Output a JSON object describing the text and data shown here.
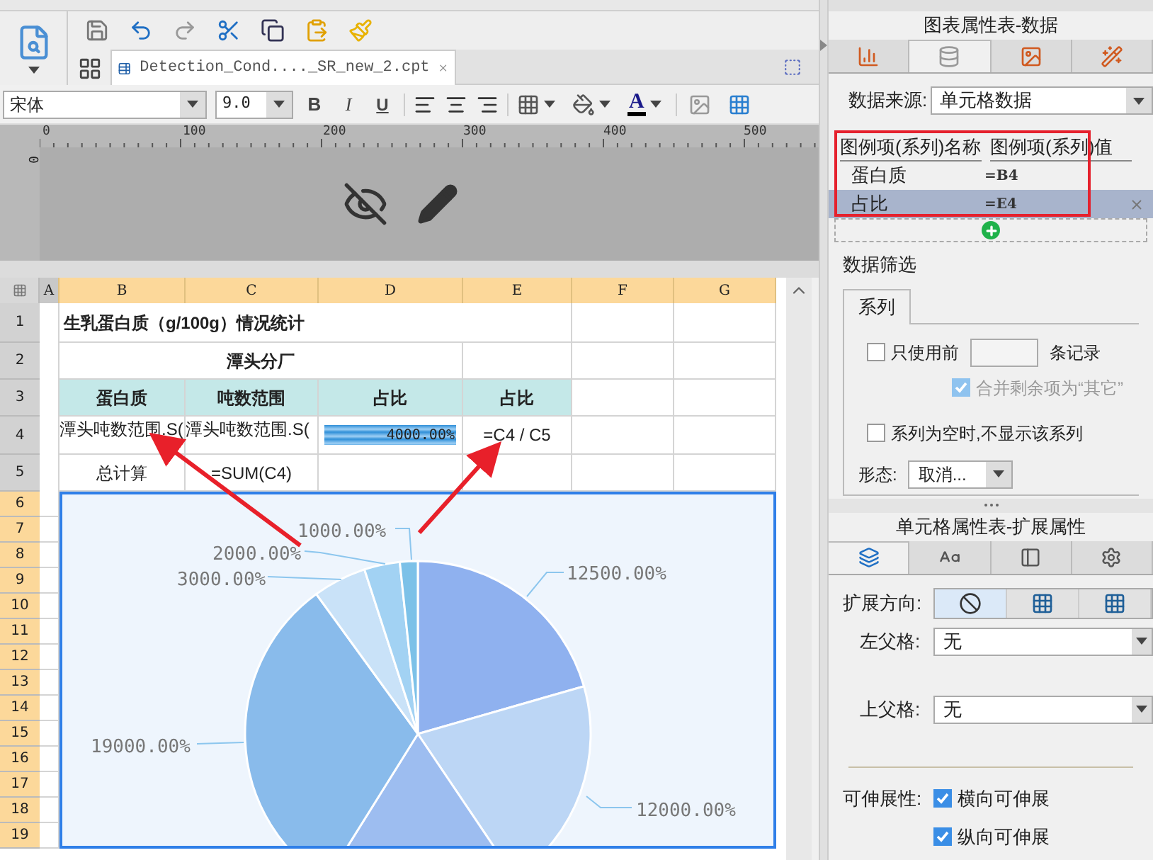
{
  "toolbar": {
    "tab_title": "Detection_Cond...._SR_new_2.cpt"
  },
  "format_bar": {
    "font": "宋体",
    "size": "9.0",
    "bold_label": "B",
    "italic_label": "I",
    "underline_label": "U",
    "font_color_label": "A"
  },
  "ruler": {
    "ticks": [
      "0",
      "100",
      "200",
      "300",
      "400",
      "500"
    ],
    "vertical_tick": "0"
  },
  "sheet": {
    "columns": [
      "A",
      "B",
      "C",
      "D",
      "E",
      "F",
      "G"
    ],
    "row_numbers": [
      "1",
      "2",
      "3",
      "4",
      "5",
      "6",
      "7",
      "8",
      "9",
      "10",
      "11",
      "12",
      "13",
      "14",
      "15",
      "16",
      "17",
      "18",
      "19"
    ],
    "title": "生乳蛋白质（g/100g）情况统计",
    "plant": "潭头分厂",
    "headers": [
      "蛋白质",
      "吨数范围",
      "占比",
      "占比"
    ],
    "row4": {
      "b": "潭头吨数范围.S(",
      "c": "潭头吨数范围.S(",
      "bar_text": "4000.00%",
      "level": 1,
      "e": "=C4 / C5"
    },
    "row5": {
      "b": "总计算",
      "c": "=SUM(C4)"
    }
  },
  "chart": {
    "labels": [
      "12500.00%",
      "12000.00%",
      "19000.00%",
      "3000.00%",
      "2000.00%",
      "1000.00%"
    ]
  },
  "chart_panel": {
    "title": "图表属性表-数据",
    "tabs": [
      {
        "selected": false
      },
      {
        "selected": true
      },
      {
        "selected": false
      },
      {
        "selected": false
      }
    ],
    "source_label": "数据来源:",
    "source_value": "单元格数据",
    "series_table": {
      "columns": [
        "图例项(系列)名称",
        "图例项(系列)值"
      ],
      "rows": [
        {
          "name": "蛋白质",
          "value": "=B4",
          "selected": false
        },
        {
          "name": "占比",
          "value": "=E4",
          "selected": true
        }
      ]
    },
    "filter": {
      "title": "数据筛选",
      "tab": "系列",
      "top_before": "只使用前",
      "top_after": "条记录",
      "top_checked": false,
      "merge_label": "合并剩余项为“其它”",
      "merge_checked": true,
      "merge_disabled": true,
      "hide_label": "系列为空时,不显示该系列",
      "hide_checked": false,
      "shape_label": "形态:",
      "shape_value": "取消..."
    }
  },
  "cell_panel": {
    "title": "单元格属性表-扩展属性",
    "tabs": [
      {
        "selected": true
      },
      {
        "selected": false
      },
      {
        "selected": false
      },
      {
        "selected": false
      }
    ],
    "direction_label": "扩展方向:",
    "directions": [
      {
        "selected": true
      },
      {
        "selected": false
      },
      {
        "selected": false
      }
    ],
    "left_parent_label": "左父格:",
    "left_parent_value": "无",
    "top_parent_label": "上父格:",
    "top_parent_value": "无",
    "stretch_label": "可伸展性:",
    "stretch_options": [
      {
        "label": "横向可伸展",
        "checked": true
      },
      {
        "label": "纵向可伸展",
        "checked": true
      }
    ]
  }
}
